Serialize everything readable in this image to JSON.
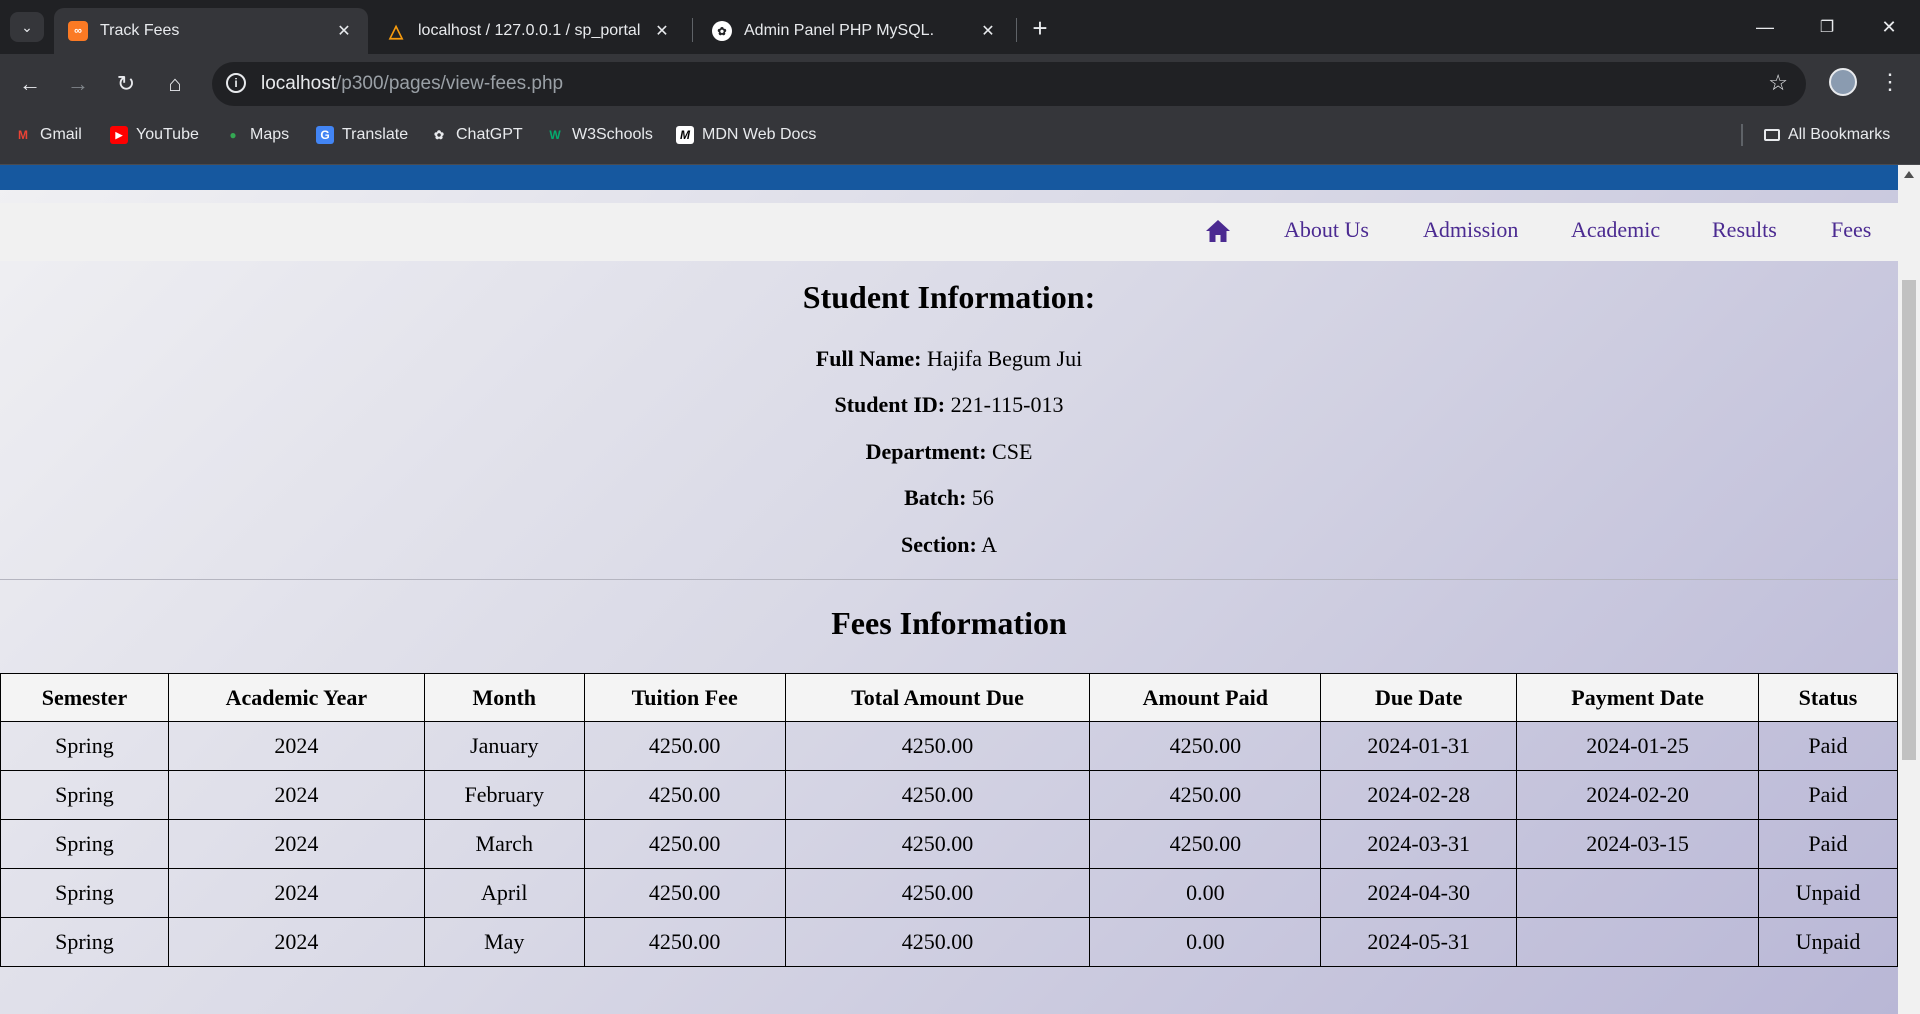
{
  "browser": {
    "tabs": [
      {
        "title": "Track Fees",
        "active": true,
        "favicon": "xampp-icon"
      },
      {
        "title": "localhost / 127.0.0.1 / sp_portal",
        "active": false,
        "favicon": "phpmyadmin-icon"
      },
      {
        "title": "Admin Panel PHP MySQL.",
        "active": false,
        "favicon": "chatgpt-icon"
      }
    ],
    "url_host": "localhost",
    "url_path": "/p300/pages/view-fees.php",
    "bookmarks": [
      "Gmail",
      "YouTube",
      "Maps",
      "Translate",
      "ChatGPT",
      "W3Schools",
      "MDN Web Docs"
    ],
    "all_bookmarks": "All Bookmarks"
  },
  "nav": {
    "links": [
      "About Us",
      "Admission",
      "Academic",
      "Results",
      "Fees"
    ]
  },
  "student": {
    "heading": "Student Information:",
    "full_name_label": "Full Name:",
    "full_name": "Hajifa Begum Jui",
    "id_label": "Student ID:",
    "id": "221-115-013",
    "department_label": "Department:",
    "department": "CSE",
    "batch_label": "Batch:",
    "batch": "56",
    "section_label": "Section:",
    "section": "A"
  },
  "fees": {
    "heading": "Fees Information",
    "columns": [
      "Semester",
      "Academic Year",
      "Month",
      "Tuition Fee",
      "Total Amount Due",
      "Amount Paid",
      "Due Date",
      "Payment Date",
      "Status"
    ],
    "rows": [
      [
        "Spring",
        "2024",
        "January",
        "4250.00",
        "4250.00",
        "4250.00",
        "2024-01-31",
        "2024-01-25",
        "Paid"
      ],
      [
        "Spring",
        "2024",
        "February",
        "4250.00",
        "4250.00",
        "4250.00",
        "2024-02-28",
        "2024-02-20",
        "Paid"
      ],
      [
        "Spring",
        "2024",
        "March",
        "4250.00",
        "4250.00",
        "4250.00",
        "2024-03-31",
        "2024-03-15",
        "Paid"
      ],
      [
        "Spring",
        "2024",
        "April",
        "4250.00",
        "4250.00",
        "0.00",
        "2024-04-30",
        "",
        "Unpaid"
      ],
      [
        "Spring",
        "2024",
        "May",
        "4250.00",
        "4250.00",
        "0.00",
        "2024-05-31",
        "",
        "Unpaid"
      ]
    ]
  },
  "colors": {
    "brand_blue": "#16589f",
    "nav_link": "#4b2a91"
  }
}
